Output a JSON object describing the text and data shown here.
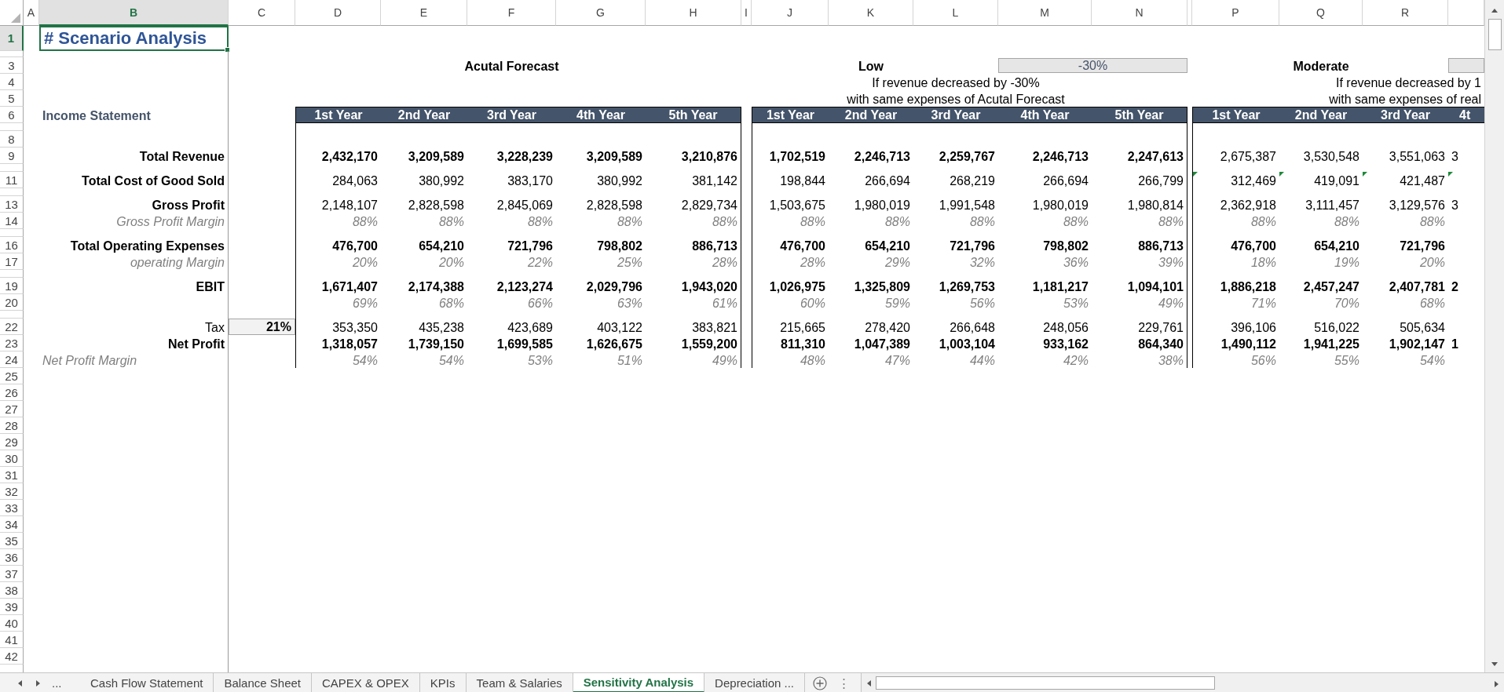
{
  "sheet": {
    "column_headers": [
      {
        "label": "A",
        "selected": false
      },
      {
        "label": "B",
        "selected": true
      },
      {
        "label": "C",
        "selected": false
      },
      {
        "label": "D",
        "selected": false
      },
      {
        "label": "E",
        "selected": false
      },
      {
        "label": "F",
        "selected": false
      },
      {
        "label": "G",
        "selected": false
      },
      {
        "label": "H",
        "selected": false
      },
      {
        "label": "I",
        "selected": false
      },
      {
        "label": "J",
        "selected": false
      },
      {
        "label": "K",
        "selected": false
      },
      {
        "label": "L",
        "selected": false
      },
      {
        "label": "M",
        "selected": false
      },
      {
        "label": "N",
        "selected": false
      },
      {
        "selected": false
      },
      {
        "label": "P",
        "selected": false
      },
      {
        "label": "Q",
        "selected": false
      },
      {
        "label": "R",
        "selected": false
      },
      {
        "selected": false
      }
    ],
    "row_headers": [
      {
        "kind": "normal",
        "label": "1",
        "selected": true
      },
      {
        "kind": "short",
        "selected": false
      },
      {
        "kind": "normal",
        "label": "3",
        "selected": false
      },
      {
        "kind": "normal",
        "label": "4",
        "selected": false
      },
      {
        "kind": "normal",
        "label": "5",
        "selected": false
      },
      {
        "kind": "normal",
        "label": "6",
        "selected": false
      },
      {
        "kind": "short",
        "selected": false
      },
      {
        "kind": "normal",
        "label": "8",
        "selected": false
      },
      {
        "kind": "normal",
        "label": "9",
        "selected": false
      },
      {
        "kind": "short",
        "selected": false
      },
      {
        "kind": "normal",
        "label": "11",
        "selected": false
      },
      {
        "kind": "short",
        "selected": false
      },
      {
        "kind": "normal",
        "label": "13",
        "selected": false
      },
      {
        "kind": "normal",
        "label": "14",
        "selected": false
      },
      {
        "kind": "short",
        "selected": false
      },
      {
        "kind": "normal",
        "label": "16",
        "selected": false
      },
      {
        "kind": "normal",
        "label": "17",
        "selected": false
      },
      {
        "kind": "short",
        "selected": false
      },
      {
        "kind": "normal",
        "label": "19",
        "selected": false
      },
      {
        "kind": "normal",
        "label": "20",
        "selected": false
      },
      {
        "kind": "short",
        "selected": false
      },
      {
        "kind": "normal",
        "label": "22",
        "selected": false
      },
      {
        "kind": "normal",
        "label": "23",
        "selected": false
      },
      {
        "kind": "normal",
        "label": "24",
        "selected": false
      },
      {
        "kind": "normal",
        "label": "25",
        "selected": false
      },
      {
        "kind": "normal",
        "label": "26",
        "selected": false
      },
      {
        "kind": "normal",
        "label": "27",
        "selected": false
      },
      {
        "kind": "normal",
        "label": "28",
        "selected": false
      },
      {
        "kind": "normal",
        "label": "29",
        "selected": false
      },
      {
        "kind": "normal",
        "label": "30",
        "selected": false
      },
      {
        "kind": "normal",
        "label": "31",
        "selected": false
      },
      {
        "kind": "normal",
        "label": "32",
        "selected": false
      },
      {
        "kind": "normal",
        "label": "33",
        "selected": false
      },
      {
        "kind": "normal",
        "label": "34",
        "selected": false
      },
      {
        "kind": "normal",
        "label": "35",
        "selected": false
      },
      {
        "kind": "normal",
        "label": "36",
        "selected": false
      },
      {
        "kind": "normal",
        "label": "37",
        "selected": false
      },
      {
        "kind": "normal",
        "label": "38",
        "selected": false
      },
      {
        "kind": "normal",
        "label": "39",
        "selected": false
      },
      {
        "kind": "normal",
        "label": "40",
        "selected": false
      },
      {
        "kind": "normal",
        "label": "41",
        "selected": false
      },
      {
        "kind": "normal",
        "label": "42",
        "selected": false
      }
    ],
    "title": {
      "text": "# Scenario Analysis",
      "selected": true
    },
    "section_label": "Income Statement",
    "line_items": [
      {
        "label": "Total Revenue",
        "kind": "bold"
      },
      {
        "label": "Total Cost of Good Sold",
        "kind": "bold"
      },
      {
        "label": "Gross Profit",
        "kind": "bold"
      },
      {
        "label": "Gross Profit Margin",
        "kind": "italic"
      },
      {
        "label": "Total Operating Expenses",
        "kind": "bold"
      },
      {
        "label": "operating Margin",
        "kind": "italic"
      },
      {
        "label": "EBIT",
        "kind": "bold"
      },
      {
        "label": "Tax",
        "kind": "plain"
      },
      {
        "label": "Net Profit",
        "kind": "bold"
      },
      {
        "label": "Net Profit Margin",
        "kind": "italic_left"
      }
    ],
    "tax_rate": "21%",
    "scenarios": [
      {
        "title": "Acutal Forecast",
        "year_headers": [
          "1st Year",
          "2nd Year",
          "3rd Year",
          "4th Year",
          "5th Year"
        ],
        "rows": [
          {
            "kind": "bold",
            "values": [
              "2,432,170",
              "3,209,589",
              "3,228,239",
              "3,209,589",
              "3,210,876"
            ]
          },
          {
            "kind": "plain",
            "values": [
              "284,063",
              "380,992",
              "383,170",
              "380,992",
              "381,142"
            ]
          },
          {
            "kind": "plain",
            "values": [
              "2,148,107",
              "2,828,598",
              "2,845,069",
              "2,828,598",
              "2,829,734"
            ]
          },
          {
            "kind": "percent",
            "values": [
              "88%",
              "88%",
              "88%",
              "88%",
              "88%"
            ]
          },
          {
            "kind": "bold",
            "values": [
              "476,700",
              "654,210",
              "721,796",
              "798,802",
              "886,713"
            ]
          },
          {
            "kind": "percent",
            "values": [
              "20%",
              "20%",
              "22%",
              "25%",
              "28%"
            ]
          },
          {
            "kind": "bold",
            "values": [
              "1,671,407",
              "2,174,388",
              "2,123,274",
              "2,029,796",
              "1,943,020"
            ]
          },
          {
            "kind": "percent",
            "values": [
              "69%",
              "68%",
              "66%",
              "63%",
              "61%"
            ]
          },
          {
            "kind": "plain",
            "values": [
              "353,350",
              "435,238",
              "423,689",
              "403,122",
              "383,821"
            ]
          },
          {
            "kind": "bold",
            "values": [
              "1,318,057",
              "1,739,150",
              "1,699,585",
              "1,626,675",
              "1,559,200"
            ]
          },
          {
            "kind": "percent",
            "values": [
              "54%",
              "54%",
              "53%",
              "51%",
              "49%"
            ]
          }
        ]
      },
      {
        "title": "Low",
        "input_field": {
          "shown": true,
          "value": "-30%"
        },
        "description": [
          "If revenue decreased by -30%",
          "with same expenses of Acutal Forecast"
        ],
        "year_headers": [
          "1st Year",
          "2nd Year",
          "3rd Year",
          "4th Year",
          "5th Year"
        ],
        "rows": [
          {
            "kind": "bold",
            "values": [
              "1,702,519",
              "2,246,713",
              "2,259,767",
              "2,246,713",
              "2,247,613"
            ]
          },
          {
            "kind": "plain",
            "values": [
              "198,844",
              "266,694",
              "268,219",
              "266,694",
              "266,799"
            ]
          },
          {
            "kind": "plain",
            "values": [
              "1,503,675",
              "1,980,019",
              "1,991,548",
              "1,980,019",
              "1,980,814"
            ]
          },
          {
            "kind": "percent",
            "values": [
              "88%",
              "88%",
              "88%",
              "88%",
              "88%"
            ]
          },
          {
            "kind": "bold",
            "values": [
              "476,700",
              "654,210",
              "721,796",
              "798,802",
              "886,713"
            ]
          },
          {
            "kind": "percent",
            "values": [
              "28%",
              "29%",
              "32%",
              "36%",
              "39%"
            ]
          },
          {
            "kind": "bold",
            "values": [
              "1,026,975",
              "1,325,809",
              "1,269,753",
              "1,181,217",
              "1,094,101"
            ]
          },
          {
            "kind": "percent",
            "values": [
              "60%",
              "59%",
              "56%",
              "53%",
              "49%"
            ]
          },
          {
            "kind": "plain",
            "values": [
              "215,665",
              "278,420",
              "266,648",
              "248,056",
              "229,761"
            ]
          },
          {
            "kind": "bold",
            "values": [
              "811,310",
              "1,047,389",
              "1,003,104",
              "933,162",
              "864,340"
            ]
          },
          {
            "kind": "percent",
            "values": [
              "48%",
              "47%",
              "44%",
              "42%",
              "38%"
            ]
          }
        ]
      },
      {
        "title": "Moderate",
        "input_field": {
          "shown": true
        },
        "description": [
          "If revenue decreased by 1",
          "with same expenses of real"
        ],
        "year_headers": [
          "1st Year",
          "2nd Year",
          "3rd Year",
          "4t"
        ],
        "rows": [
          {
            "kind": "plain",
            "values": [
              "2,675,387",
              "3,530,548",
              "3,551,063",
              "3"
            ]
          },
          {
            "kind": "plain",
            "flagged": true,
            "values": [
              "312,469",
              "419,091",
              "421,487"
            ]
          },
          {
            "kind": "plain",
            "values": [
              "2,362,918",
              "3,111,457",
              "3,129,576",
              "3"
            ]
          },
          {
            "kind": "percent",
            "values": [
              "88%",
              "88%",
              "88%"
            ]
          },
          {
            "kind": "bold",
            "values": [
              "476,700",
              "654,210",
              "721,796"
            ]
          },
          {
            "kind": "percent",
            "values": [
              "18%",
              "19%",
              "20%"
            ]
          },
          {
            "kind": "bold",
            "values": [
              "1,886,218",
              "2,457,247",
              "2,407,781",
              "2"
            ]
          },
          {
            "kind": "percent",
            "values": [
              "71%",
              "70%",
              "68%"
            ]
          },
          {
            "kind": "plain",
            "values": [
              "396,106",
              "516,022",
              "505,634"
            ]
          },
          {
            "kind": "bold",
            "values": [
              "1,490,112",
              "1,941,225",
              "1,902,147",
              "1"
            ]
          },
          {
            "kind": "percent",
            "values": [
              "56%",
              "55%",
              "54%"
            ]
          }
        ]
      }
    ]
  },
  "sheet_tabs": {
    "more": "...",
    "tabs": [
      {
        "label": "Cash Flow Statement",
        "selected": false
      },
      {
        "label": "Balance Sheet",
        "selected": false
      },
      {
        "label": "CAPEX & OPEX",
        "selected": false
      },
      {
        "label": "KPIs",
        "selected": false
      },
      {
        "label": "Team & Salaries",
        "selected": false
      },
      {
        "label": "Sensitivity Analysis",
        "selected": true
      },
      {
        "label": "Depreciation ...",
        "selected": false
      }
    ],
    "options": "⋮"
  }
}
